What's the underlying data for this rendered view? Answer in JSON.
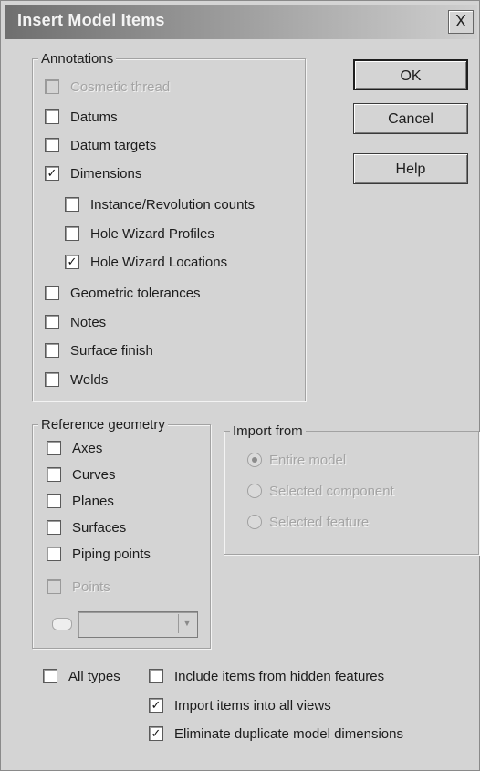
{
  "window": {
    "title": "Insert Model Items",
    "close_glyph": "X"
  },
  "buttons": {
    "ok": "OK",
    "cancel": "Cancel",
    "help": "Help"
  },
  "annotations": {
    "legend": "Annotations",
    "items": [
      {
        "label": "Cosmetic thread",
        "checked": false,
        "enabled": false
      },
      {
        "label": "Datums",
        "checked": false,
        "enabled": true
      },
      {
        "label": "Datum targets",
        "checked": false,
        "enabled": true
      },
      {
        "label": "Dimensions",
        "checked": true,
        "enabled": true
      },
      {
        "label": "Instance/Revolution counts",
        "checked": false,
        "enabled": true
      },
      {
        "label": "Hole Wizard Profiles",
        "checked": false,
        "enabled": true
      },
      {
        "label": "Hole Wizard Locations",
        "checked": true,
        "enabled": true
      },
      {
        "label": "Geometric tolerances",
        "checked": false,
        "enabled": true
      },
      {
        "label": "Notes",
        "checked": false,
        "enabled": true
      },
      {
        "label": "Surface finish",
        "checked": false,
        "enabled": true
      },
      {
        "label": "Welds",
        "checked": false,
        "enabled": true
      }
    ]
  },
  "reference_geometry": {
    "legend": "Reference geometry",
    "items": [
      {
        "label": "Axes",
        "checked": false,
        "enabled": true
      },
      {
        "label": "Curves",
        "checked": false,
        "enabled": true
      },
      {
        "label": "Planes",
        "checked": false,
        "enabled": true
      },
      {
        "label": "Surfaces",
        "checked": false,
        "enabled": true
      },
      {
        "label": "Piping points",
        "checked": false,
        "enabled": true
      },
      {
        "label": "Points",
        "checked": false,
        "enabled": false
      }
    ],
    "combo_value": "",
    "combo_icon": "pushpin-icon"
  },
  "import_from": {
    "legend": "Import from",
    "options": [
      {
        "label": "Entire model",
        "selected": true
      },
      {
        "label": "Selected component",
        "selected": false
      },
      {
        "label": "Selected feature",
        "selected": false
      }
    ],
    "enabled": false
  },
  "bottom": {
    "all_types": {
      "label": "All types",
      "checked": false
    },
    "options": [
      {
        "label": "Include items from hidden features",
        "checked": false
      },
      {
        "label": "Import items into all views",
        "checked": true
      },
      {
        "label": "Eliminate duplicate model dimensions",
        "checked": true
      }
    ]
  },
  "colors": {
    "face": "#d4d4d4",
    "disabled_text": "#a4a4a4"
  }
}
